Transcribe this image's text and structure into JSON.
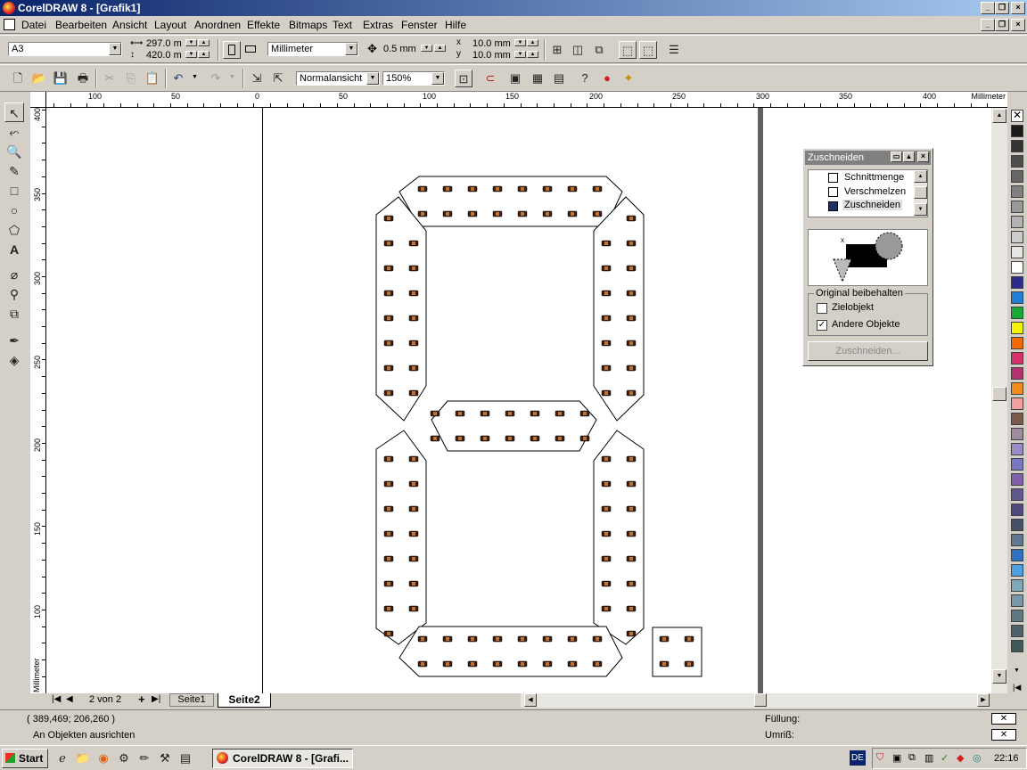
{
  "window": {
    "title": "CorelDRAW 8 - [Grafik1]"
  },
  "menu": [
    "Datei",
    "Bearbeiten",
    "Ansicht",
    "Layout",
    "Anordnen",
    "Effekte",
    "Bitmaps",
    "Text",
    "Extras",
    "Fenster",
    "Hilfe"
  ],
  "property_bar": {
    "paper_size": "A3",
    "width": "297.0 m",
    "height": "420.0 m",
    "units": "Millimeter",
    "nudge": "0.5 mm",
    "dup_x": "10.0 mm",
    "dup_y": "10.0 mm"
  },
  "standard_bar": {
    "view_mode": "Normalansicht",
    "zoom": "150%"
  },
  "ruler": {
    "unit_label": "Millimeter",
    "h_labels": [
      "100",
      "50",
      "0",
      "50",
      "100",
      "150",
      "200",
      "250",
      "300",
      "350",
      "400"
    ],
    "v_labels": [
      "400",
      "350",
      "300",
      "250",
      "200",
      "150",
      "100"
    ],
    "v_unit": "Millimeter"
  },
  "page_nav": {
    "indicator": "2 von 2",
    "tabs": [
      "Seite1",
      "Seite2"
    ],
    "active_tab": "Seite2"
  },
  "docker": {
    "title": "Zuschneiden",
    "list": [
      "Schnittmenge",
      "Verschmelzen",
      "Zuschneiden"
    ],
    "selected": "Zuschneiden",
    "group_label": "Original beibehalten",
    "options": [
      {
        "label": "Zielobjekt",
        "checked": false
      },
      {
        "label": "Andere Objekte",
        "checked": true
      }
    ],
    "apply_button": "Zuschneiden..."
  },
  "status": {
    "coords": "( 389,469; 206,260 )",
    "message": "An Objekten ausrichten",
    "fill_label": "Füllung:",
    "outline_label": "Umriß:"
  },
  "taskbar": {
    "start": "Start",
    "task": "CorelDRAW 8 - [Grafi...",
    "lang": "DE",
    "clock": "22:16"
  },
  "palette_colors": [
    "#1a1a1a",
    "#333333",
    "#4d4d4d",
    "#666666",
    "#808080",
    "#999999",
    "#b3b3b3",
    "#cccccc",
    "#e6e6e6",
    "#ffffff",
    "#2b2b8c",
    "#1f7fd6",
    "#18a838",
    "#f5f500",
    "#f26a00",
    "#d6306a",
    "#b43270",
    "#f28c1e",
    "#f5a0a0",
    "#7a5a4a",
    "#a08aa0",
    "#9a8ac8",
    "#7878c0",
    "#8060a8",
    "#605890",
    "#504880",
    "#485068",
    "#607890",
    "#3070c0",
    "#50a0e0",
    "#80a8b8",
    "#7898a8",
    "#607880",
    "#506068",
    "#405858"
  ]
}
